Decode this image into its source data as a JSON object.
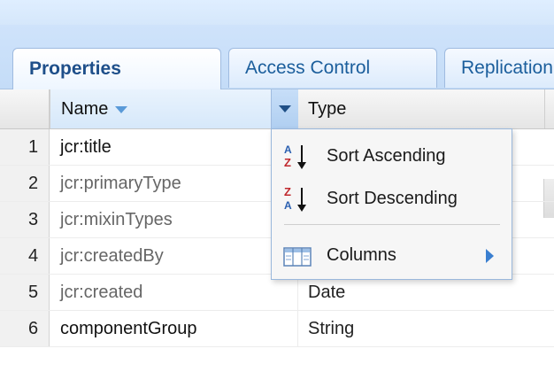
{
  "tabs": [
    {
      "label": "Properties",
      "active": true
    },
    {
      "label": "Access Control",
      "active": false
    },
    {
      "label": "Replication",
      "active": false
    }
  ],
  "grid": {
    "columns": {
      "name": "Name",
      "type": "Type"
    },
    "rows": [
      {
        "num": "1",
        "name": "jcr:title",
        "type": ""
      },
      {
        "num": "2",
        "name": "jcr:primaryType",
        "type": ""
      },
      {
        "num": "3",
        "name": "jcr:mixinTypes",
        "type": ""
      },
      {
        "num": "4",
        "name": "jcr:createdBy",
        "type": ""
      },
      {
        "num": "5",
        "name": "jcr:created",
        "type": "Date"
      },
      {
        "num": "6",
        "name": "componentGroup",
        "type": "String"
      }
    ]
  },
  "menu": {
    "sort_asc": "Sort Ascending",
    "sort_desc": "Sort Descending",
    "columns": "Columns"
  },
  "colors": {
    "tab_text": "#1b5e9c",
    "accent": "#5a9ad8",
    "menu_border": "#9ab8dc"
  },
  "icons": {
    "sort_asc": "sort-ascending-icon",
    "sort_desc": "sort-descending-icon",
    "columns": "columns-icon"
  }
}
